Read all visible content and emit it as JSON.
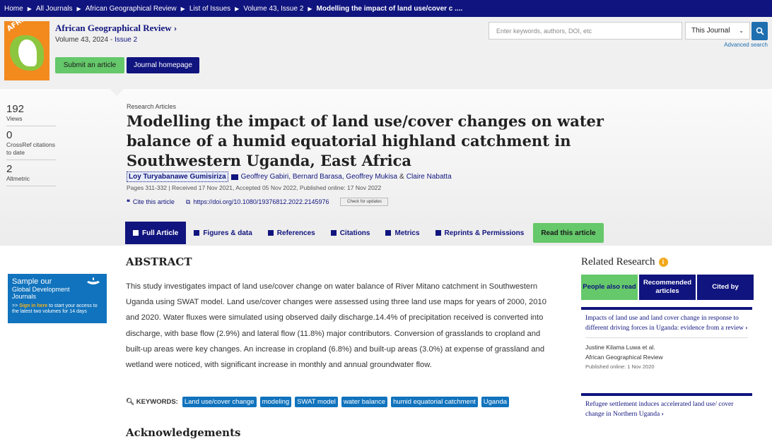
{
  "breadcrumb": [
    "Home",
    "All Journals",
    "African Geographical Review",
    "List of Issues",
    "Volume 43, Issue 2",
    "Modelling the impact of land use/cover c ...."
  ],
  "journal": {
    "title": "African Geographical Review",
    "title_suffix": "›",
    "volume_prefix": "Volume 43, 2024 - ",
    "issue": "Issue 2",
    "submit": "Submit an article",
    "homepage": "Journal homepage",
    "cover_word": "AFRICAN"
  },
  "search": {
    "placeholder": "Enter keywords, authors, DOI, etc",
    "scope": "This Journal",
    "advanced": "Advanced search"
  },
  "metrics": [
    {
      "value": "192",
      "label": "Views"
    },
    {
      "value": "0",
      "label": "CrossRef citations to date"
    },
    {
      "value": "2",
      "label": "Altmetric"
    }
  ],
  "article": {
    "type": "Research Articles",
    "title": "Modelling the impact of land use/cover changes on water balance of a humid equatorial highland catchment in Southwestern Uganda, East Africa",
    "author_first": "Loy Turyabanawe Gumisiriza",
    "authors_rest": "Geoffrey Gabiri, Bernard Barasa, Geoffrey Mukisa",
    "amp": "&",
    "author_last": "Claire Nabatta",
    "dates": "Pages 311-332 | Received 17 Nov 2021, Accepted 05 Nov 2022, Published online: 17 Nov 2022",
    "cite": "Cite this article",
    "doi": "https://doi.org/10.1080/19376812.2022.2145976",
    "check": "Check for updates"
  },
  "tabs": [
    "Full Article",
    "Figures & data",
    "References",
    "Citations",
    "Metrics",
    "Reprints & Permissions",
    "Read this article"
  ],
  "ad": {
    "line1": "Sample our",
    "line2": "Global Development",
    "line3": "Journals",
    "small_prefix": ">> ",
    "small_link": "Sign in here",
    "small_rest": " to start your access to the latest two volumes for 14 days"
  },
  "abstract": {
    "heading": "ABSTRACT",
    "text": "This study investigates impact of land use/cover change on water balance of River Mitano catchment in Southwestern Uganda using SWAT model. Land use/cover changes were assessed using three land use maps for years of 2000, 2010 and 2020. Water fluxes were simulated using observed daily discharge.14.4% of precipitation received is converted into discharge, with base flow (2.9%) and lateral flow (11.8%) major contributors. Conversion of grasslands to cropland and built-up areas were key changes. An increase in cropland (6.8%) and built-up areas (3.0%) at expense of grassland and wetland were noticed, with significant increase in monthly and annual groundwater flow."
  },
  "keywords": {
    "label": "KEYWORDS:",
    "items": [
      "Land use/cover change",
      "modeling",
      "SWAT model",
      "water balance",
      "humid equatorial catchment",
      "Uganda"
    ]
  },
  "next_heading": "Acknowledgements",
  "related": {
    "heading": "Related Research",
    "info": "i",
    "tabs": [
      "People also read",
      "Recommended articles",
      "Cited by"
    ],
    "items": [
      {
        "title": "Impacts of land use and land cover change in response to different driving forces in Uganda: evidence from a review",
        "author": "Justine Kilama Luwa et al.",
        "journal": "African Geographical Review",
        "published": "Published online: 1 Nov 2020"
      },
      {
        "title": "Refugee settlement induces accelerated land use/ cover change in Northern Uganda"
      }
    ]
  }
}
